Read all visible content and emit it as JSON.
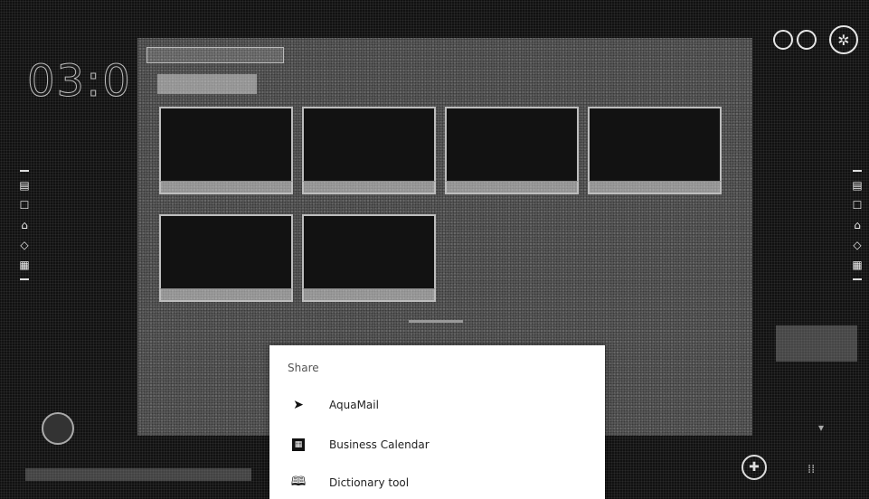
{
  "status": {
    "clock": "03:0"
  },
  "share_sheet": {
    "title": "Share",
    "items": [
      {
        "label": "AquaMail",
        "icon": "aquamail-icon"
      },
      {
        "label": "Business Calendar",
        "icon": "calendar-icon"
      },
      {
        "label": "Dictionary tool",
        "icon": "book-icon"
      }
    ]
  },
  "colors": {
    "sheet_background": "#ffffff",
    "screen_background": "#0b0b0b",
    "panel_gray": "#5a5a5a"
  }
}
